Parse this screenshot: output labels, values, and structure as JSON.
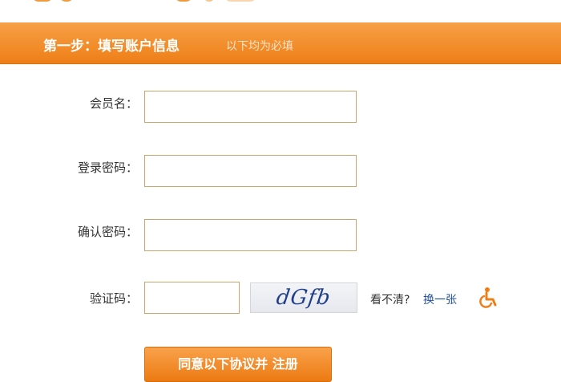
{
  "header": {
    "title": "第一步：填写账户信息",
    "subtitle": "以下均为必填"
  },
  "form": {
    "member_name_label": "会员名：",
    "login_password_label": "登录密码：",
    "confirm_password_label": "确认密码：",
    "captcha_label": "验证码：",
    "captcha_image_text": "dGfb",
    "unclear_text": "看不清?",
    "refresh_link": "换一张",
    "submit_label": "同意以下协议并 注册"
  },
  "colors": {
    "accent": "#ee7f18",
    "input_border": "#c9a66c",
    "link": "#1f4f9c"
  },
  "icons": {
    "accessibility": "wheelchair-icon"
  }
}
